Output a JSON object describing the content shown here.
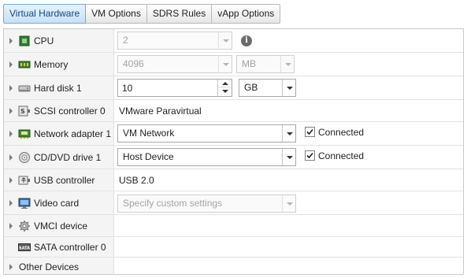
{
  "tabs": [
    "Virtual Hardware",
    "VM Options",
    "SDRS Rules",
    "vApp Options"
  ],
  "active_tab": "Virtual Hardware",
  "accent": "#0d4a87",
  "devices": {
    "cpu": {
      "label": "CPU",
      "icon": "cpu-icon",
      "value": "2"
    },
    "memory": {
      "label": "Memory",
      "icon": "memory-icon",
      "value": "4096",
      "unit": "MB"
    },
    "hard_disk": {
      "label": "Hard disk 1",
      "icon": "hard-disk-icon",
      "value": "10",
      "unit": "GB"
    },
    "scsi": {
      "label": "SCSI controller 0",
      "icon": "scsi-controller-icon",
      "value": "VMware Paravirtual"
    },
    "network": {
      "label": "Network adapter 1",
      "icon": "network-adapter-icon",
      "value": "VM Network",
      "connected_label": "Connected",
      "connected": true
    },
    "cdrom": {
      "label": "CD/DVD drive 1",
      "icon": "cd-dvd-icon",
      "value": "Host Device",
      "connected_label": "Connected",
      "connected": true
    },
    "usb": {
      "label": "USB controller",
      "icon": "usb-icon",
      "value": "USB 2.0"
    },
    "video": {
      "label": "Video card",
      "icon": "video-card-icon",
      "placeholder": "Specify custom settings"
    },
    "vmci": {
      "label": "VMCI device",
      "icon": "vmci-gear-icon"
    },
    "sata": {
      "label": "SATA controller 0",
      "icon": "sata-controller-icon",
      "badge": "SATA"
    },
    "other": {
      "label": "Other Devices"
    }
  }
}
